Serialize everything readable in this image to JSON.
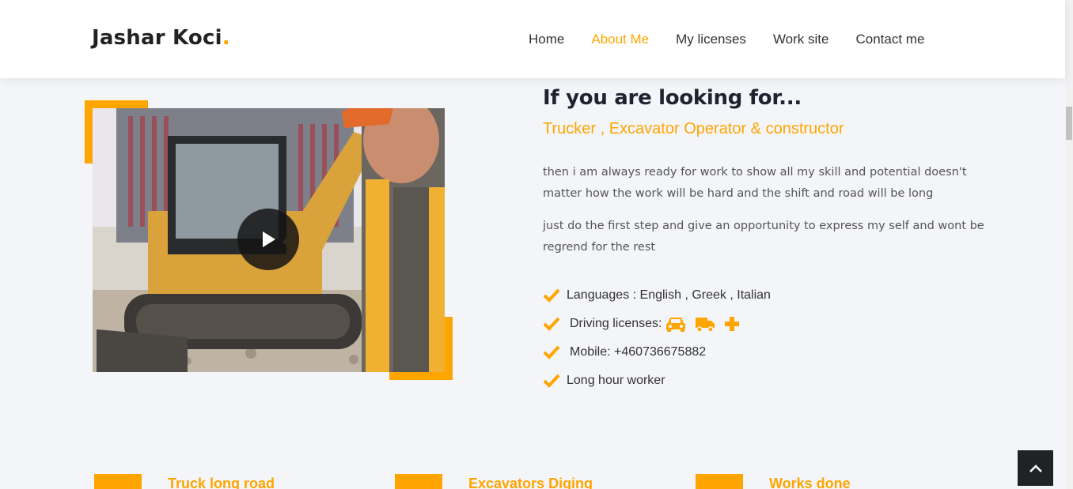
{
  "header": {
    "logo_text": "Jashar Koci",
    "logo_dot": ".",
    "nav": [
      {
        "label": "Home",
        "active": false
      },
      {
        "label": "About Me",
        "active": true
      },
      {
        "label": "My licenses",
        "active": false
      },
      {
        "label": "Work site",
        "active": false
      },
      {
        "label": "Contact me",
        "active": false
      }
    ]
  },
  "about": {
    "title": "If you are looking for...",
    "subtitle": "Trucker , Excavator Operator & constructor",
    "paragraph1": "then i am always ready for work to show all my skill and potential doesn't matter how the work will be hard and the shift and road will be long",
    "paragraph2": "just do the first step and give an opportunity to express my self and wont be regrend for the rest",
    "list": [
      {
        "text": "Languages : English , Greek , Italian"
      },
      {
        "text": "Driving licenses:",
        "icons": [
          "car-icon",
          "truck-icon",
          "plus-icon"
        ]
      },
      {
        "text": "Mobile: +460736675882"
      },
      {
        "text": "Long hour worker"
      }
    ]
  },
  "features": [
    {
      "title": "Truck long road"
    },
    {
      "title": "Excavators Diging"
    },
    {
      "title": "Works done"
    }
  ],
  "colors": {
    "accent": "#ffa500",
    "text_dark": "#1f2330",
    "background": "#f4f5f8"
  }
}
